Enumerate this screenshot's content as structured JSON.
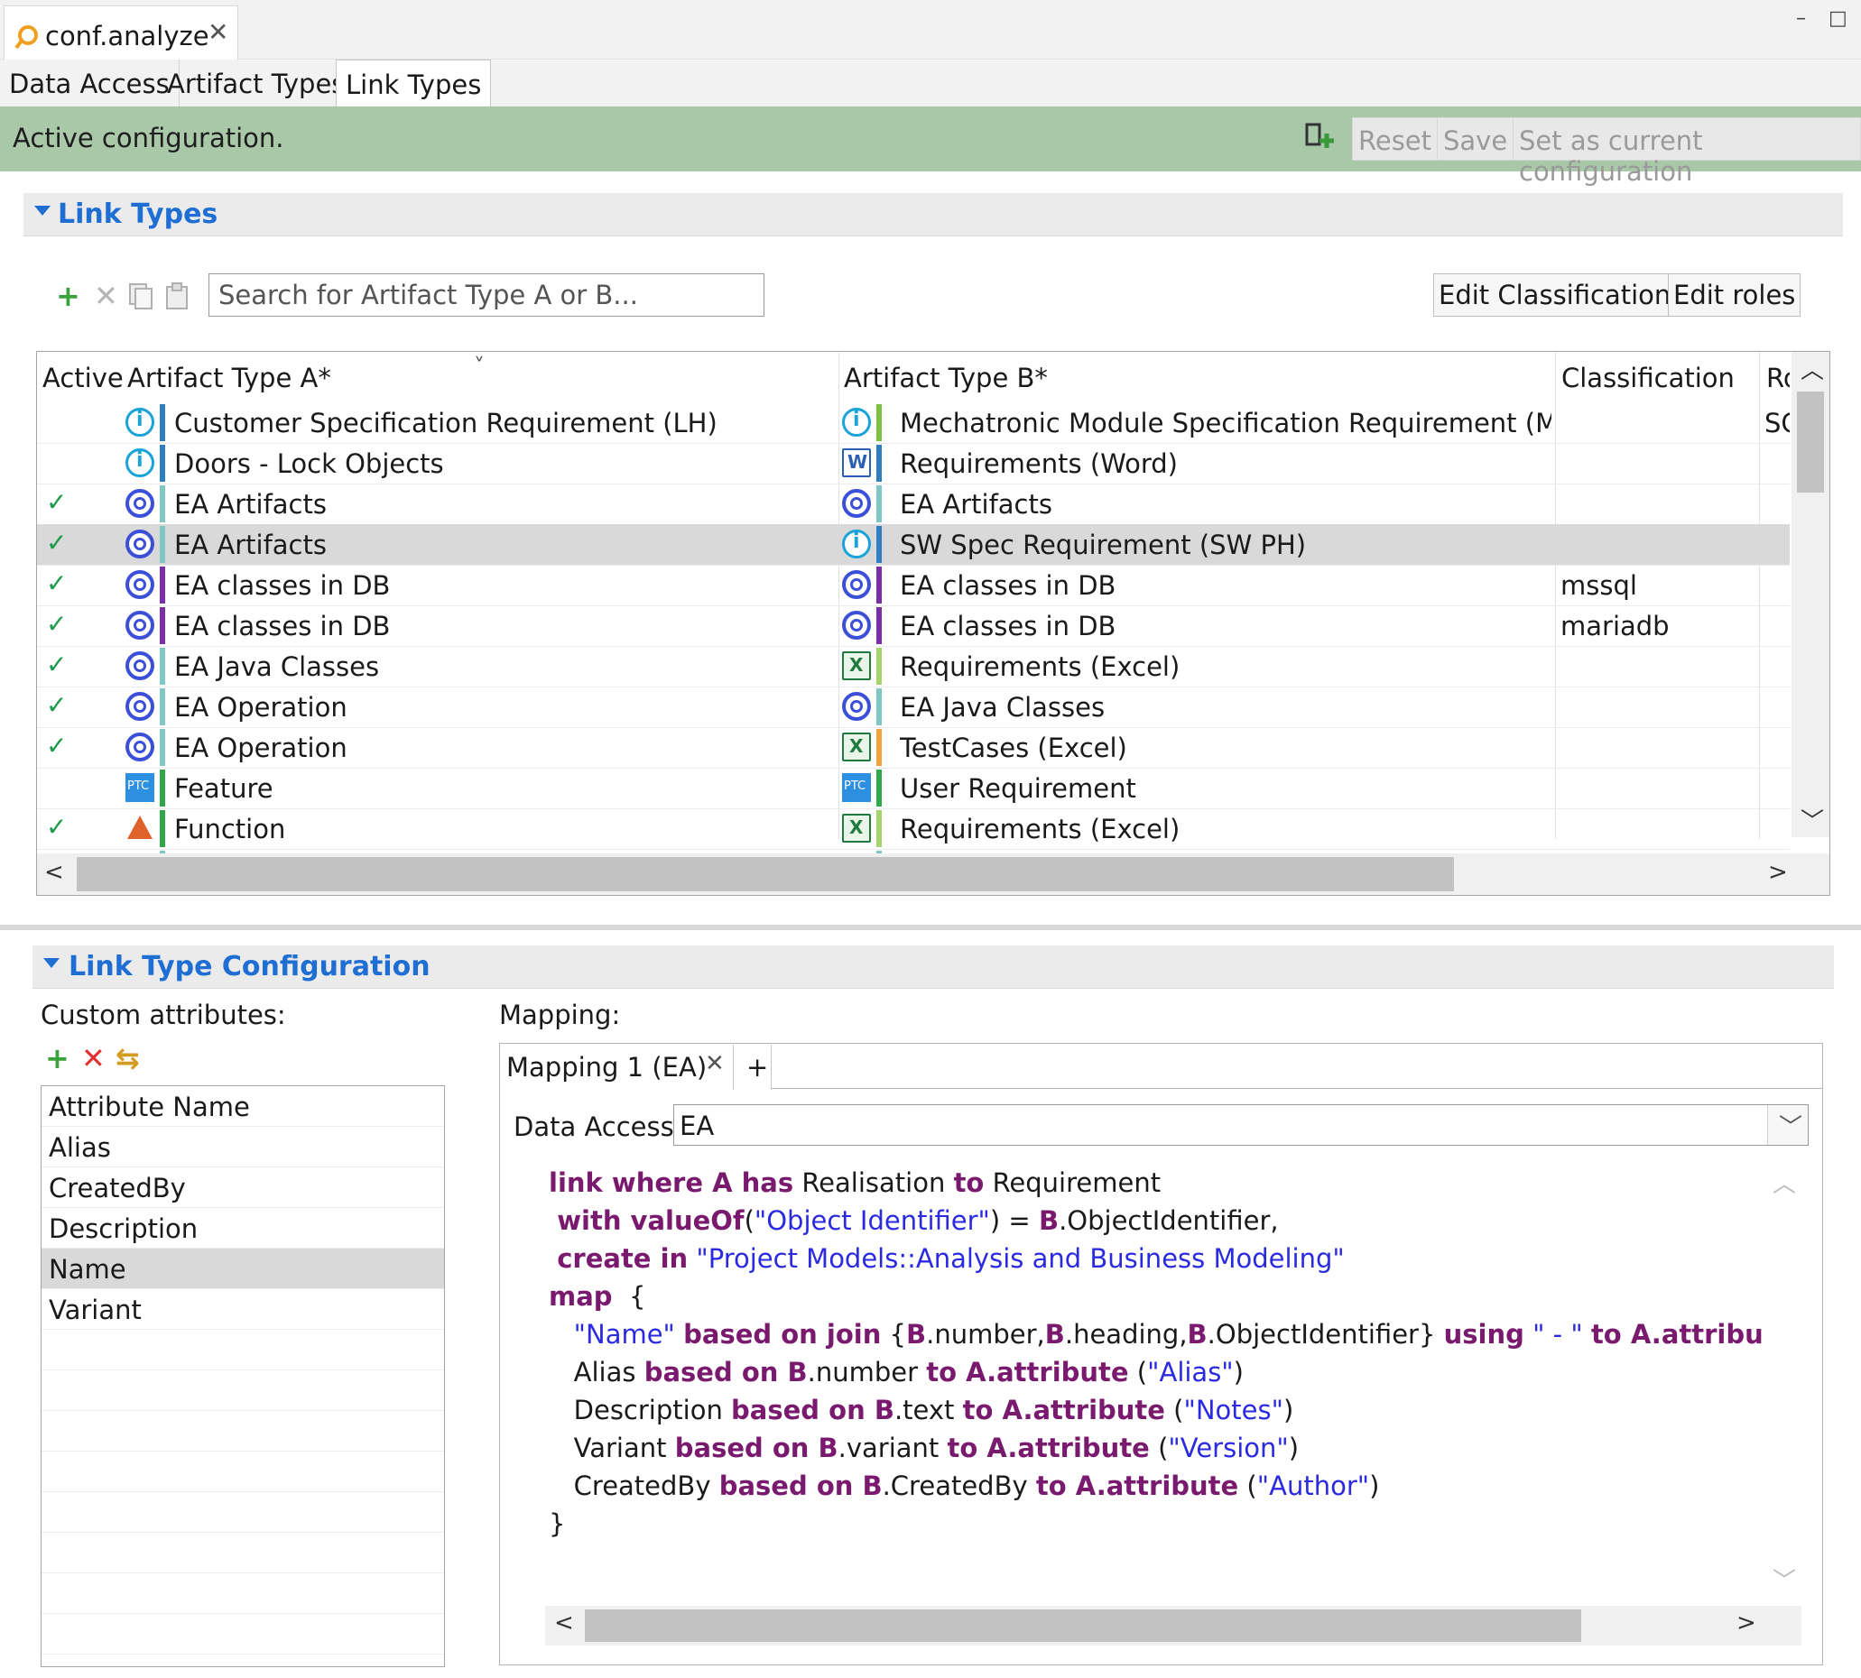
{
  "editor": {
    "tab_title": "conf.analyze",
    "close_glyph": "✕",
    "minimize_glyph": "–",
    "maximize_glyph": "□"
  },
  "page_tabs": [
    "Data Access",
    "Artifact Types",
    "Link Types"
  ],
  "banner": {
    "message": "Active configuration.",
    "buttons": [
      "Reset",
      "Save",
      "Set as current configuration"
    ],
    "color": "#a8c8a8"
  },
  "link_types_section": {
    "title": "Link Types",
    "search_placeholder": "Search for Artifact Type A or B...",
    "edit_classifications": "Edit Classifications",
    "edit_roles": "Edit roles",
    "columns": [
      "Active",
      "Artifact Type A*",
      "Artifact Type B*",
      "Classification",
      "Ro"
    ],
    "sort_glyph": "˅",
    "check_glyph": "✓",
    "rows": [
      {
        "active": false,
        "a_icon": "doors-icon",
        "a_color": "#2f7ebf",
        "a": "Customer Specification Requirement (LH)",
        "b_icon": "doors-icon",
        "b_color": "#7cc143",
        "b": "Mechatronic Module Specification Requirement (MM P",
        "classification": "",
        "role": "SC"
      },
      {
        "active": false,
        "a_icon": "doors-icon",
        "a_color": "#2f7ebf",
        "a": "Doors - Lock Objects",
        "b_icon": "word-icon",
        "b_color": "#2f7ebf",
        "b": "Requirements (Word)",
        "classification": "",
        "role": ""
      },
      {
        "active": true,
        "a_icon": "ea-icon",
        "a_color": "#7fc7c2",
        "a": "EA Artifacts",
        "b_icon": "ea-icon",
        "b_color": "#7fc7c2",
        "b": "EA Artifacts",
        "classification": "",
        "role": ""
      },
      {
        "active": true,
        "a_icon": "ea-icon",
        "a_color": "#7fc7c2",
        "a": "EA Artifacts",
        "b_icon": "doors-icon",
        "b_color": "#2f7ebf",
        "b": "SW Spec Requirement (SW PH)",
        "classification": "",
        "role": ""
      },
      {
        "active": true,
        "a_icon": "ea-icon",
        "a_color": "#7a2ea8",
        "a": "EA classes in DB",
        "b_icon": "ea-icon",
        "b_color": "#7a2ea8",
        "b": "EA classes in DB",
        "classification": "mssql",
        "role": ""
      },
      {
        "active": true,
        "a_icon": "ea-icon",
        "a_color": "#7a2ea8",
        "a": "EA classes in DB",
        "b_icon": "ea-icon",
        "b_color": "#7a2ea8",
        "b": "EA classes in DB",
        "classification": "mariadb",
        "role": ""
      },
      {
        "active": true,
        "a_icon": "ea-icon",
        "a_color": "#7fc7c2",
        "a": "EA Java Classes",
        "b_icon": "excel-icon",
        "b_color": "#a5d46a",
        "b": "Requirements (Excel)",
        "classification": "",
        "role": ""
      },
      {
        "active": true,
        "a_icon": "ea-icon",
        "a_color": "#7fc7c2",
        "a": "EA Operation",
        "b_icon": "ea-icon",
        "b_color": "#7fc7c2",
        "b": "EA Java Classes",
        "classification": "",
        "role": ""
      },
      {
        "active": true,
        "a_icon": "ea-icon",
        "a_color": "#7fc7c2",
        "a": "EA Operation",
        "b_icon": "excel-icon",
        "b_color": "#f0a33a",
        "b": "TestCases (Excel)",
        "classification": "",
        "role": ""
      },
      {
        "active": false,
        "a_icon": "ptc-icon",
        "a_color": "#2fa84a",
        "a": "Feature",
        "b_icon": "ptc-icon",
        "b_color": "#2fa84a",
        "b": "User Requirement",
        "classification": "",
        "role": ""
      },
      {
        "active": true,
        "a_icon": "matlab-icon",
        "a_color": "#2fa84a",
        "a": "Function",
        "b_icon": "excel-icon",
        "b_color": "#a5d46a",
        "b": "Requirements (Excel)",
        "classification": "",
        "role": ""
      }
    ],
    "selected_row": 3
  },
  "config_section": {
    "title": "Link Type Configuration",
    "custom_attributes_label": "Custom attributes:",
    "mapping_label": "Mapping:",
    "attributes": [
      "Attribute Name",
      "Alias",
      "CreatedBy",
      "Description",
      "Name",
      "Variant"
    ],
    "selected_attribute": "Name",
    "mapping_tab": "Mapping 1 (EA)",
    "add_tab": "+",
    "data_access_label": "Data Access:",
    "data_access_value": "EA",
    "code_lines": [
      [
        {
          "k": "kw",
          "t": "link where A has"
        },
        {
          "k": "",
          "t": " Realisation "
        },
        {
          "k": "kw",
          "t": "to"
        },
        {
          "k": "",
          "t": " Requirement"
        }
      ],
      [
        {
          "k": "",
          "t": " "
        },
        {
          "k": "kw",
          "t": "with valueOf"
        },
        {
          "k": "",
          "t": "("
        },
        {
          "k": "str",
          "t": "\"Object Identifier\""
        },
        {
          "k": "",
          "t": ") = "
        },
        {
          "k": "kw",
          "t": "B"
        },
        {
          "k": "",
          "t": ".ObjectIdentifier,"
        }
      ],
      [
        {
          "k": "",
          "t": " "
        },
        {
          "k": "kw",
          "t": "create in"
        },
        {
          "k": "",
          "t": " "
        },
        {
          "k": "str",
          "t": "\"Project Models::Analysis and Business Modeling\""
        }
      ],
      [
        {
          "k": "kw",
          "t": "map"
        },
        {
          "k": "",
          "t": "  {"
        }
      ],
      [
        {
          "k": "",
          "t": "   "
        },
        {
          "k": "str",
          "t": "\"Name\""
        },
        {
          "k": "",
          "t": " "
        },
        {
          "k": "kw",
          "t": "based on join"
        },
        {
          "k": "",
          "t": " {"
        },
        {
          "k": "kw",
          "t": "B"
        },
        {
          "k": "",
          "t": ".number,"
        },
        {
          "k": "kw",
          "t": "B"
        },
        {
          "k": "",
          "t": ".heading,"
        },
        {
          "k": "kw",
          "t": "B"
        },
        {
          "k": "",
          "t": ".ObjectIdentifier} "
        },
        {
          "k": "kw",
          "t": "using"
        },
        {
          "k": "",
          "t": " "
        },
        {
          "k": "str",
          "t": "\" - \""
        },
        {
          "k": "",
          "t": " "
        },
        {
          "k": "kw",
          "t": "to A.attribute"
        },
        {
          "k": "",
          "t": "("
        },
        {
          "k": "str",
          "t": "\"Name\""
        },
        {
          "k": "",
          "t": ")"
        }
      ],
      [
        {
          "k": "",
          "t": "   Alias "
        },
        {
          "k": "kw",
          "t": "based on B"
        },
        {
          "k": "",
          "t": ".number "
        },
        {
          "k": "kw",
          "t": "to A.attribute"
        },
        {
          "k": "",
          "t": " ("
        },
        {
          "k": "str",
          "t": "\"Alias\""
        },
        {
          "k": "",
          "t": ")"
        }
      ],
      [
        {
          "k": "",
          "t": "   Description "
        },
        {
          "k": "kw",
          "t": "based on B"
        },
        {
          "k": "",
          "t": ".text "
        },
        {
          "k": "kw",
          "t": "to A.attribute"
        },
        {
          "k": "",
          "t": " ("
        },
        {
          "k": "str",
          "t": "\"Notes\""
        },
        {
          "k": "",
          "t": ")"
        }
      ],
      [
        {
          "k": "",
          "t": "   Variant "
        },
        {
          "k": "kw",
          "t": "based on B"
        },
        {
          "k": "",
          "t": ".variant "
        },
        {
          "k": "kw",
          "t": "to A.attribute"
        },
        {
          "k": "",
          "t": " ("
        },
        {
          "k": "str",
          "t": "\"Version\""
        },
        {
          "k": "",
          "t": ")"
        }
      ],
      [
        {
          "k": "",
          "t": "   CreatedBy "
        },
        {
          "k": "kw",
          "t": "based on B"
        },
        {
          "k": "",
          "t": ".CreatedBy "
        },
        {
          "k": "kw",
          "t": "to A.attribute"
        },
        {
          "k": "",
          "t": " ("
        },
        {
          "k": "str",
          "t": "\"Author\""
        },
        {
          "k": "",
          "t": ")"
        }
      ],
      [
        {
          "k": "",
          "t": "}"
        }
      ]
    ]
  },
  "colors": {
    "accent": "#1f6ed4",
    "keyword": "#7a1a6e",
    "string": "#2a2ae0",
    "check": "#1a9a4a",
    "selection": "#d9d9d9"
  }
}
